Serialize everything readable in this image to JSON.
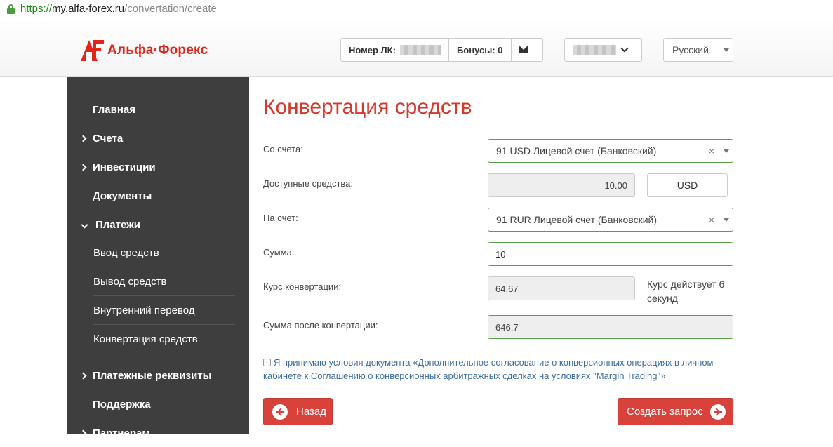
{
  "browser": {
    "scheme": "https://",
    "host": "my.alfa-forex.ru",
    "path": "/convertation/create"
  },
  "header": {
    "logo_text": "Альфа·Форекс",
    "account_label": "Номер ЛК:",
    "bonuses": "Бонусы: 0",
    "language": "Русский"
  },
  "sidebar": {
    "items": [
      {
        "label": "Главная"
      },
      {
        "label": "Счета"
      },
      {
        "label": "Инвестиции"
      },
      {
        "label": "Документы"
      },
      {
        "label": "Платежи"
      },
      {
        "label": "Ввод средств"
      },
      {
        "label": "Вывод средств"
      },
      {
        "label": "Внутренний перевод"
      },
      {
        "label": "Конвертация средств"
      },
      {
        "label": "Платежные реквизиты"
      },
      {
        "label": "Поддержка"
      },
      {
        "label": "Партнерам"
      }
    ]
  },
  "main": {
    "title": "Конвертация средств",
    "from_label": "Со счета:",
    "from_value": "91        USD Лицевой счет (Банковский)",
    "available_label": "Доступные средства:",
    "available_value": "10.00",
    "currency": "USD",
    "to_label": "На счет:",
    "to_value": "91        RUR Лицевой счет (Банковский)",
    "amount_label": "Сумма:",
    "amount_value": "10",
    "rate_label": "Курс конвертации:",
    "rate_value": "64.67",
    "rate_note": "Курс действует 6 секунд",
    "result_label": "Сумма после конвертации:",
    "result_value": "646.7",
    "agree_text": "Я принимаю условия документа «Дополнительное согласование о конверсионных операциях в личном кабинете к Соглашению о конверсионных арбитражных сделках на условиях \"Margin Trading\"»",
    "back_label": "Назад",
    "submit_label": "Создать запрос"
  },
  "colors": {
    "accent": "#d9423b",
    "sidebar": "#3e3e3e",
    "title": "#d4392e",
    "link": "#3b6e9e",
    "valid": "#5aa04a"
  }
}
